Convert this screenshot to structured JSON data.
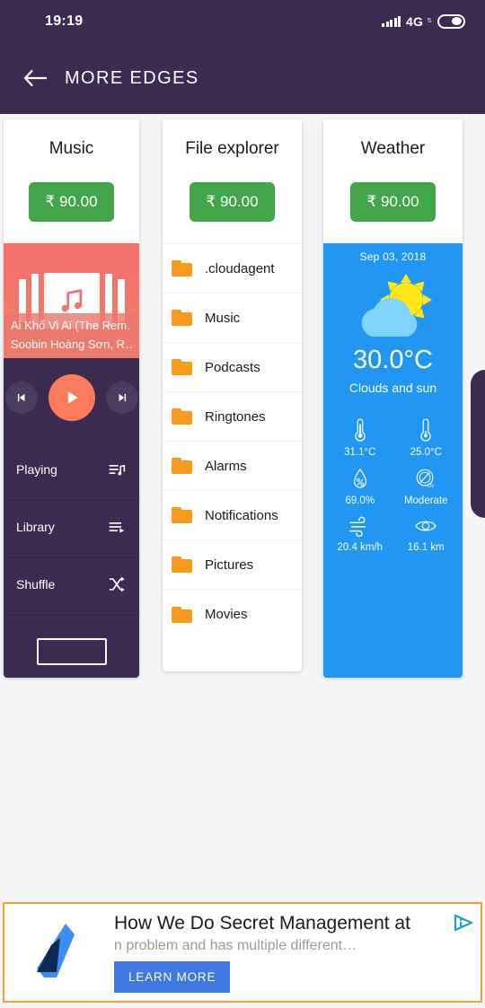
{
  "statusbar": {
    "time": "19:19",
    "network": "4G",
    "network_arrows": "⇅",
    "signal_icon": "signal-bars-icon",
    "battery_icon": "battery-icon"
  },
  "appbar": {
    "back_icon": "back-arrow-icon",
    "title": "MORE EDGES"
  },
  "cards": {
    "music": {
      "title": "Music",
      "price": "₹ 90.00",
      "album_icon": "music-note-icon",
      "track_title": "Ai Khổ Vi Ai (The Rem…",
      "track_artist": "Soobin Hoàng Sơn, R…",
      "controls": {
        "previous": "skip-previous-icon",
        "play": "play-icon",
        "next": "skip-next-icon"
      },
      "rows": [
        {
          "label": "Playing",
          "icon": "queue-music-icon"
        },
        {
          "label": "Library",
          "icon": "playlist-play-icon"
        },
        {
          "label": "Shuffle",
          "icon": "shuffle-icon"
        }
      ]
    },
    "files": {
      "title": "File explorer",
      "price": "₹ 90.00",
      "folders": [
        ".cloudagent",
        "Music",
        "Podcasts",
        "Ringtones",
        "Alarms",
        "Notifications",
        "Pictures",
        "Movies"
      ]
    },
    "weather": {
      "title": "Weather",
      "price": "₹ 90.00",
      "date": "Sep 03, 2018",
      "condition_icon": "cloud-sun-icon",
      "temperature": "30.0°C",
      "description": "Clouds and sun",
      "details": [
        {
          "icon": "thermometer-high-icon",
          "value": "31.1°C"
        },
        {
          "icon": "thermometer-low-icon",
          "value": "25.0°C"
        },
        {
          "icon": "humidity-icon",
          "value": "69.0%"
        },
        {
          "icon": "uv-index-icon",
          "value": "Moderate"
        },
        {
          "icon": "wind-icon",
          "value": "20.4 km/h"
        },
        {
          "icon": "visibility-icon",
          "value": "16.1 km"
        }
      ]
    }
  },
  "ad": {
    "logo_icon": "advertiser-logo-icon",
    "headline": "How We Do Secret Management at",
    "subtext": "n problem and has multiple different…",
    "cta": "LEARN MORE",
    "adchoices_icon": "adchoices-icon"
  },
  "colors": {
    "appbar": "#3b2a52",
    "price_green": "#42a648",
    "weather_blue": "#2196f3",
    "accent_coral": "#fb7b5c",
    "folder_orange": "#f79a1e",
    "ad_border": "#f5a02e",
    "ad_cta_blue": "#3f78e3"
  }
}
